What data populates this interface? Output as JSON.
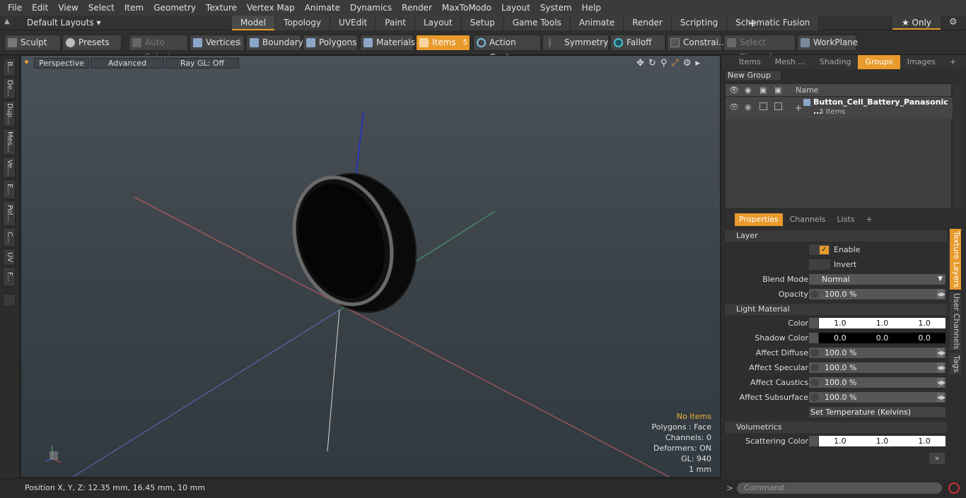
{
  "menu": [
    "File",
    "Edit",
    "View",
    "Select",
    "Item",
    "Geometry",
    "Texture",
    "Vertex Map",
    "Animate",
    "Dynamics",
    "Render",
    "MaxToModo",
    "Layout",
    "System",
    "Help"
  ],
  "layout_selector": "Default Layouts ▾",
  "layout_tabs": [
    "Model",
    "Topology",
    "UVEdit",
    "Paint",
    "Layout",
    "Setup",
    "Game Tools",
    "Animate",
    "Render",
    "Scripting",
    "Schematic Fusion"
  ],
  "active_layout_tab": "Model",
  "only_label": "★ Only",
  "toolbar": {
    "sculpt": "Sculpt",
    "presets": "Presets",
    "auto_select": "Auto Select",
    "vertices": "Vertices",
    "vertices_count": "1",
    "boundary": "Boundary",
    "polygons": "Polygons",
    "materials": "Materials",
    "items": "Items",
    "items_count": "5",
    "action_center": "Action Center",
    "symmetry": "Symmetry",
    "falloff": "Falloff",
    "constraints": "Constrai...",
    "select_through": "Select Through",
    "workplane": "WorkPlane"
  },
  "left_tabs": [
    "B...",
    "De...",
    "Dup...",
    "Mes...",
    "Ve...",
    "E...",
    "Pol...",
    "C...",
    "UV",
    "F..."
  ],
  "viewport": {
    "view": "Perspective",
    "shading": "Advanced",
    "raygl": "Ray GL: Off",
    "info": {
      "no_items": "No Items",
      "polygons": "Polygons : Face",
      "channels": "Channels: 0",
      "deformers": "Deformers: ON",
      "gl": "GL: 940",
      "unit": "1 mm"
    }
  },
  "status": "Position X, Y, Z:   12.35 mm, 16.45 mm, 10 mm",
  "right_tabs": [
    "Items",
    "Mesh ...",
    "Shading",
    "Groups",
    "Images"
  ],
  "active_right_tab": "Groups",
  "new_group": "New Group",
  "group_table": {
    "name_header": "Name",
    "group_name": "Button_Cell_Battery_Panasonic ...",
    "group_count": "3 Items"
  },
  "prop_tabs": [
    "Properties",
    "Channels",
    "Lists"
  ],
  "layer": {
    "title": "Layer",
    "enable": "Enable",
    "invert": "Invert",
    "blend_mode_label": "Blend Mode",
    "blend_mode": "Normal",
    "opacity_label": "Opacity",
    "opacity": "100.0 %"
  },
  "light_material": {
    "title": "Light Material",
    "color_label": "Color",
    "color": [
      "1.0",
      "1.0",
      "1.0"
    ],
    "shadow_label": "Shadow Color",
    "shadow": [
      "0.0",
      "0.0",
      "0.0"
    ],
    "affect_diffuse_label": "Affect Diffuse",
    "affect_diffuse": "100.0 %",
    "affect_specular_label": "Affect Specular",
    "affect_specular": "100.0 %",
    "affect_caustics_label": "Affect Caustics",
    "affect_caustics": "100.0 %",
    "affect_subsurface_label": "Affect Subsurface",
    "affect_subsurface": "100.0 %",
    "set_temp": "Set Temperature (Kelvins)"
  },
  "volumetrics": {
    "title": "Volumetrics",
    "scattering_label": "Scattering Color",
    "scattering": [
      "1.0",
      "1.0",
      "1.0"
    ]
  },
  "side_tabs": [
    "Texture Layers",
    "User Channels",
    "Tags"
  ],
  "command_placeholder": "Command"
}
